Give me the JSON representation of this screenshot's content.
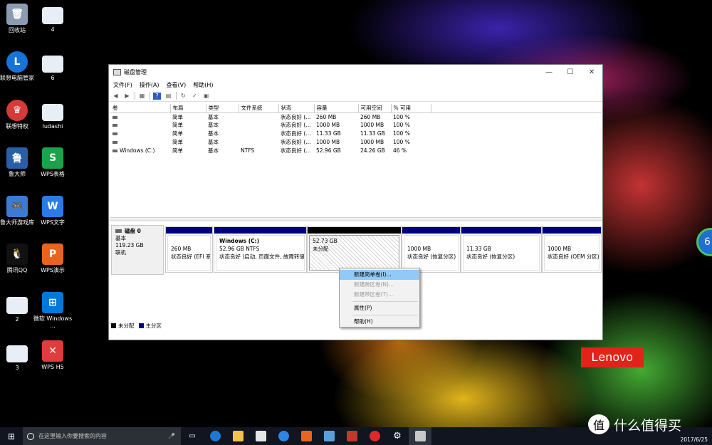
{
  "desktop": {
    "icons_left": [
      {
        "label": "回收站",
        "color": "#8b9bb0"
      },
      {
        "label": "联想电脑管家",
        "color": "#1673d8"
      },
      {
        "label": "联想特权",
        "color": "#d63a3a"
      },
      {
        "label": "鲁大师",
        "color": "#2a5fa8"
      },
      {
        "label": "鲁大师游戏库",
        "color": "#3a7bd5"
      },
      {
        "label": "腾讯QQ",
        "color": "#111111"
      },
      {
        "label": "2",
        "color": "#e8eef5"
      },
      {
        "label": "3",
        "color": "#e8eef5"
      }
    ],
    "icons_right": [
      {
        "label": "4",
        "color": "#e8eef5"
      },
      {
        "label": "6",
        "color": "#e8eef5"
      },
      {
        "label": "ludashi",
        "color": "#e8eef5"
      },
      {
        "label": "WPS表格",
        "color": "#1aa34a"
      },
      {
        "label": "WPS文字",
        "color": "#2b7be4"
      },
      {
        "label": "WPS演示",
        "color": "#e8641f"
      },
      {
        "label": "微软 Windows ...",
        "color": "#0078d7"
      },
      {
        "label": "WPS H5",
        "color": "#e23b3b"
      }
    ],
    "brand": "Lenovo",
    "edge_widget": "6"
  },
  "window": {
    "title": "磁盘管理",
    "menu": [
      "文件(F)",
      "操作(A)",
      "查看(V)",
      "帮助(H)"
    ],
    "columns": [
      "卷",
      "布局",
      "类型",
      "文件系统",
      "状态",
      "容量",
      "可用空间",
      "% 可用"
    ],
    "rows": [
      {
        "vol": "",
        "layout": "简单",
        "type": "基本",
        "fs": "",
        "status": "状态良好 (...",
        "cap": "260 MB",
        "free": "260 MB",
        "pct": "100 %"
      },
      {
        "vol": "",
        "layout": "简单",
        "type": "基本",
        "fs": "",
        "status": "状态良好 (...",
        "cap": "1000 MB",
        "free": "1000 MB",
        "pct": "100 %"
      },
      {
        "vol": "",
        "layout": "简单",
        "type": "基本",
        "fs": "",
        "status": "状态良好 (...",
        "cap": "11.33 GB",
        "free": "11.33 GB",
        "pct": "100 %"
      },
      {
        "vol": "",
        "layout": "简单",
        "type": "基本",
        "fs": "",
        "status": "状态良好 (...",
        "cap": "1000 MB",
        "free": "1000 MB",
        "pct": "100 %"
      },
      {
        "vol": "Windows (C:)",
        "layout": "简单",
        "type": "基本",
        "fs": "NTFS",
        "status": "状态良好 (...",
        "cap": "52.96 GB",
        "free": "24.26 GB",
        "pct": "46 %"
      }
    ],
    "disk": {
      "name": "磁盘 0",
      "type": "基本",
      "size": "119.23 GB",
      "state": "联机"
    },
    "partitions": [
      {
        "name": "",
        "size": "260 MB",
        "status": "状态良好 (EFI 系"
      },
      {
        "name": "Windows  (C:)",
        "size": "52.96 GB NTFS",
        "status": "状态良好 (启动, 页面文件, 故障转储"
      },
      {
        "name": "",
        "size": "52.73 GB",
        "status": "未分配"
      },
      {
        "name": "",
        "size": "1000 MB",
        "status": "状态良好 (恢复分区)"
      },
      {
        "name": "",
        "size": "11.33 GB",
        "status": "状态良好 (恢复分区)"
      },
      {
        "name": "",
        "size": "1000 MB",
        "status": "状态良好 (OEM 分区)"
      }
    ],
    "legend": {
      "unallocated": "未分配",
      "primary": "主分区"
    }
  },
  "context_menu": {
    "items": [
      {
        "label": "新建简单卷(I)...",
        "state": "highlighted"
      },
      {
        "label": "新建跨区卷(N)...",
        "state": "disabled"
      },
      {
        "label": "新建带区卷(T)...",
        "state": "disabled"
      },
      {
        "label": "属性(P)",
        "state": "normal"
      },
      {
        "label": "帮助(H)",
        "state": "normal"
      }
    ]
  },
  "taskbar": {
    "search_placeholder": "在这里输入你要搜索的内容",
    "date": "2017/6/25"
  },
  "watermark": "什么值得买"
}
